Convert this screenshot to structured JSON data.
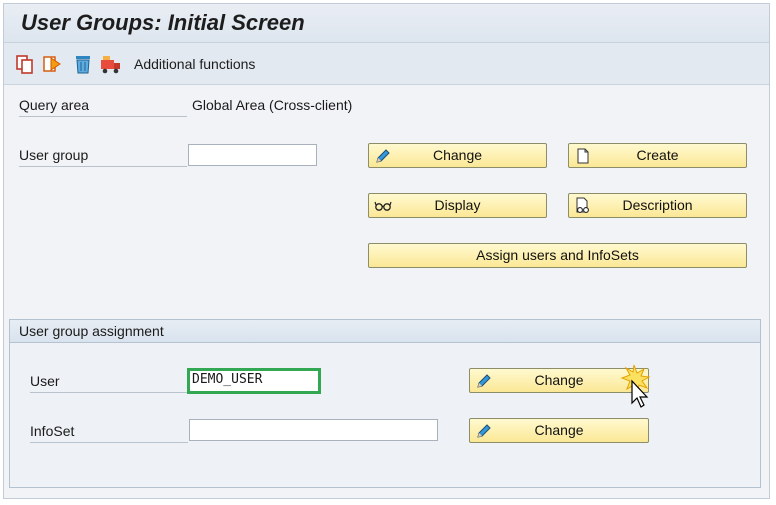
{
  "window": {
    "title": "User Groups: Initial Screen"
  },
  "toolbar": {
    "icons": [
      "copy-icon",
      "execute-icon",
      "delete-icon",
      "transport-icon"
    ],
    "additional_functions": "Additional functions"
  },
  "top_section": {
    "query_area_label": "Query area",
    "query_area_value": "Global Area (Cross-client)",
    "user_group_label": "User group",
    "user_group_value": "",
    "buttons": {
      "change": "Change",
      "create": "Create",
      "display": "Display",
      "description": "Description",
      "assign": "Assign users and InfoSets"
    }
  },
  "assignment": {
    "title": "User group assignment",
    "user_label": "User",
    "user_value": "DEMO_USER",
    "infoset_label": "InfoSet",
    "infoset_value": "",
    "change_user": "Change",
    "change_infoset": "Change"
  },
  "colors": {
    "button_bg": "#fbe895",
    "focus_border": "#33a853",
    "title_bar": "#dde5ee"
  }
}
